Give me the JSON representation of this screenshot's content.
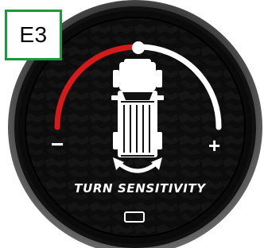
{
  "tag": {
    "label": "E3"
  },
  "dial": {
    "caption": "TURN SENSITIVITY",
    "minus_label": "−",
    "plus_label": "+",
    "active_color": "#d41a1a",
    "track_color": "#ffffff",
    "level": 0.5
  },
  "tag_border_color": "#1a9a3a"
}
